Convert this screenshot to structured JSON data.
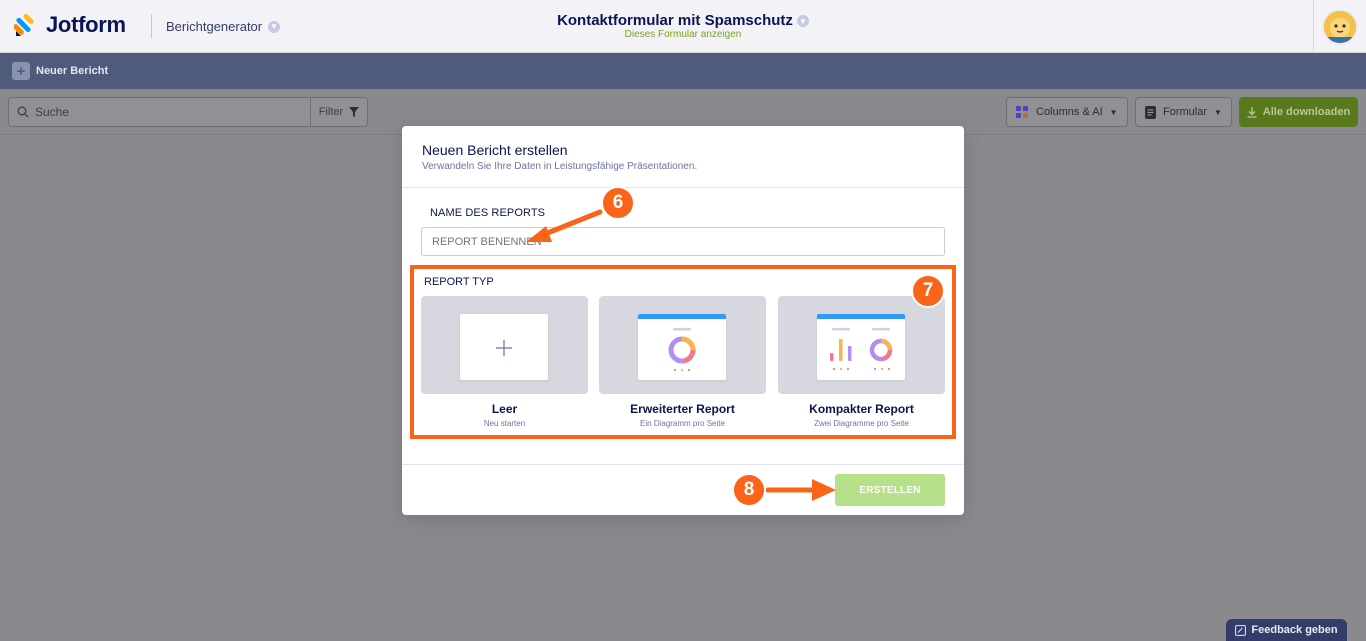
{
  "header": {
    "logo_text": "Jotform",
    "builder_label": "Berichtgenerator",
    "form_title": "Kontaktformular mit Spamschutz",
    "form_subtitle": "Dieses Formular anzeigen"
  },
  "toolbar": {
    "new_report_label": "Neuer Bericht"
  },
  "controls": {
    "search_placeholder": "Suche",
    "filter_label": "Filter",
    "columns_label": "Columns & AI",
    "form_label": "Formular",
    "download_all_label": "Alle downloaden"
  },
  "modal": {
    "title": "Neuen Bericht erstellen",
    "subtitle": "Verwandeln Sie Ihre Daten in Leistungsfähige Präsentationen.",
    "name_label": "NAME DES REPORTS",
    "name_placeholder": "REPORT BENENNEN",
    "type_label": "REPORT TYP",
    "report_types": [
      {
        "title": "Leer",
        "subtitle": "Neu starten"
      },
      {
        "title": "Erweiterter Report",
        "subtitle": "Ein Diagramm pro Seite"
      },
      {
        "title": "Kompakter Report",
        "subtitle": "Zwei Diagramme pro Seite"
      }
    ],
    "create_label": "ERSTELLEN"
  },
  "annotations": {
    "badge_6": "6",
    "badge_7": "7",
    "badge_8": "8",
    "color": "#fa6419"
  },
  "feedback_label": "Feedback geben",
  "colors": {
    "brand_dark": "#0a1551",
    "toolbar": "#4f5b7a",
    "accent_green": "#7aa21f",
    "create_button": "#b6e089",
    "thumb_bar": "#2e9cf3"
  }
}
